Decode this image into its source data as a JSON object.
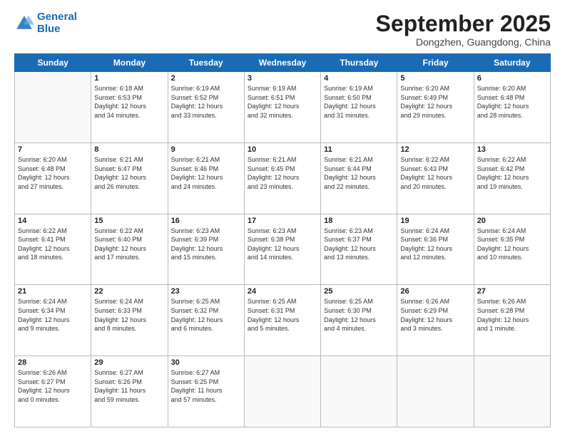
{
  "logo": {
    "line1": "General",
    "line2": "Blue"
  },
  "header": {
    "month": "September 2025",
    "location": "Dongzhen, Guangdong, China"
  },
  "days_of_week": [
    "Sunday",
    "Monday",
    "Tuesday",
    "Wednesday",
    "Thursday",
    "Friday",
    "Saturday"
  ],
  "weeks": [
    [
      {
        "day": "",
        "info": ""
      },
      {
        "day": "1",
        "info": "Sunrise: 6:18 AM\nSunset: 6:53 PM\nDaylight: 12 hours\nand 34 minutes."
      },
      {
        "day": "2",
        "info": "Sunrise: 6:19 AM\nSunset: 6:52 PM\nDaylight: 12 hours\nand 33 minutes."
      },
      {
        "day": "3",
        "info": "Sunrise: 6:19 AM\nSunset: 6:51 PM\nDaylight: 12 hours\nand 32 minutes."
      },
      {
        "day": "4",
        "info": "Sunrise: 6:19 AM\nSunset: 6:50 PM\nDaylight: 12 hours\nand 31 minutes."
      },
      {
        "day": "5",
        "info": "Sunrise: 6:20 AM\nSunset: 6:49 PM\nDaylight: 12 hours\nand 29 minutes."
      },
      {
        "day": "6",
        "info": "Sunrise: 6:20 AM\nSunset: 6:48 PM\nDaylight: 12 hours\nand 28 minutes."
      }
    ],
    [
      {
        "day": "7",
        "info": "Sunrise: 6:20 AM\nSunset: 6:48 PM\nDaylight: 12 hours\nand 27 minutes."
      },
      {
        "day": "8",
        "info": "Sunrise: 6:21 AM\nSunset: 6:47 PM\nDaylight: 12 hours\nand 26 minutes."
      },
      {
        "day": "9",
        "info": "Sunrise: 6:21 AM\nSunset: 6:46 PM\nDaylight: 12 hours\nand 24 minutes."
      },
      {
        "day": "10",
        "info": "Sunrise: 6:21 AM\nSunset: 6:45 PM\nDaylight: 12 hours\nand 23 minutes."
      },
      {
        "day": "11",
        "info": "Sunrise: 6:21 AM\nSunset: 6:44 PM\nDaylight: 12 hours\nand 22 minutes."
      },
      {
        "day": "12",
        "info": "Sunrise: 6:22 AM\nSunset: 6:43 PM\nDaylight: 12 hours\nand 20 minutes."
      },
      {
        "day": "13",
        "info": "Sunrise: 6:22 AM\nSunset: 6:42 PM\nDaylight: 12 hours\nand 19 minutes."
      }
    ],
    [
      {
        "day": "14",
        "info": "Sunrise: 6:22 AM\nSunset: 6:41 PM\nDaylight: 12 hours\nand 18 minutes."
      },
      {
        "day": "15",
        "info": "Sunrise: 6:22 AM\nSunset: 6:40 PM\nDaylight: 12 hours\nand 17 minutes."
      },
      {
        "day": "16",
        "info": "Sunrise: 6:23 AM\nSunset: 6:39 PM\nDaylight: 12 hours\nand 15 minutes."
      },
      {
        "day": "17",
        "info": "Sunrise: 6:23 AM\nSunset: 6:38 PM\nDaylight: 12 hours\nand 14 minutes."
      },
      {
        "day": "18",
        "info": "Sunrise: 6:23 AM\nSunset: 6:37 PM\nDaylight: 12 hours\nand 13 minutes."
      },
      {
        "day": "19",
        "info": "Sunrise: 6:24 AM\nSunset: 6:36 PM\nDaylight: 12 hours\nand 12 minutes."
      },
      {
        "day": "20",
        "info": "Sunrise: 6:24 AM\nSunset: 6:35 PM\nDaylight: 12 hours\nand 10 minutes."
      }
    ],
    [
      {
        "day": "21",
        "info": "Sunrise: 6:24 AM\nSunset: 6:34 PM\nDaylight: 12 hours\nand 9 minutes."
      },
      {
        "day": "22",
        "info": "Sunrise: 6:24 AM\nSunset: 6:33 PM\nDaylight: 12 hours\nand 8 minutes."
      },
      {
        "day": "23",
        "info": "Sunrise: 6:25 AM\nSunset: 6:32 PM\nDaylight: 12 hours\nand 6 minutes."
      },
      {
        "day": "24",
        "info": "Sunrise: 6:25 AM\nSunset: 6:31 PM\nDaylight: 12 hours\nand 5 minutes."
      },
      {
        "day": "25",
        "info": "Sunrise: 6:25 AM\nSunset: 6:30 PM\nDaylight: 12 hours\nand 4 minutes."
      },
      {
        "day": "26",
        "info": "Sunrise: 6:26 AM\nSunset: 6:29 PM\nDaylight: 12 hours\nand 3 minutes."
      },
      {
        "day": "27",
        "info": "Sunrise: 6:26 AM\nSunset: 6:28 PM\nDaylight: 12 hours\nand 1 minute."
      }
    ],
    [
      {
        "day": "28",
        "info": "Sunrise: 6:26 AM\nSunset: 6:27 PM\nDaylight: 12 hours\nand 0 minutes."
      },
      {
        "day": "29",
        "info": "Sunrise: 6:27 AM\nSunset: 6:26 PM\nDaylight: 11 hours\nand 59 minutes."
      },
      {
        "day": "30",
        "info": "Sunrise: 6:27 AM\nSunset: 6:25 PM\nDaylight: 11 hours\nand 57 minutes."
      },
      {
        "day": "",
        "info": ""
      },
      {
        "day": "",
        "info": ""
      },
      {
        "day": "",
        "info": ""
      },
      {
        "day": "",
        "info": ""
      }
    ]
  ]
}
